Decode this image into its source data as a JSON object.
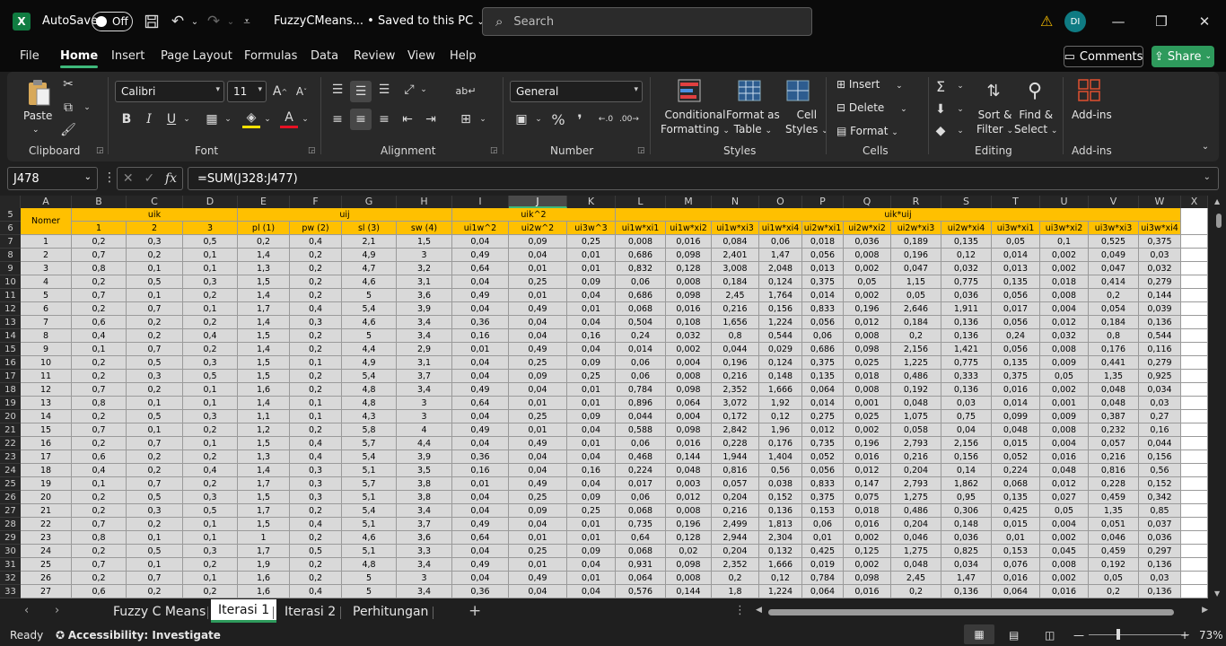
{
  "titlebar": {
    "logo": "X",
    "autosave_label": "AutoSave",
    "autosave_state": "Off",
    "doc_title": "FuzzyCMeans...  •  Saved to this PC",
    "search_placeholder": "Search",
    "avatar_initials": "DI"
  },
  "menu": {
    "tabs": [
      "File",
      "Home",
      "Insert",
      "Page Layout",
      "Formulas",
      "Data",
      "Review",
      "View",
      "Help"
    ],
    "active": "Home",
    "comments_label": "Comments",
    "share_label": "Share"
  },
  "ribbon": {
    "groups": [
      "Clipboard",
      "Font",
      "Alignment",
      "Number",
      "Styles",
      "Cells",
      "Editing",
      "Add-ins"
    ],
    "paste_label": "Paste",
    "font_name": "Calibri",
    "font_size": "11",
    "number_format": "General",
    "conditional_formatting": [
      "Conditional",
      "Formatting"
    ],
    "format_as_table": [
      "Format as",
      "Table"
    ],
    "cell_styles": [
      "Cell",
      "Styles"
    ],
    "insert_label": "Insert",
    "delete_label": "Delete",
    "format_label": "Format",
    "sort_filter": [
      "Sort &",
      "Filter"
    ],
    "find_select": [
      "Find &",
      "Select"
    ],
    "addins_label": "Add-ins"
  },
  "formula_bar": {
    "name_box": "J478",
    "formula": "=SUM(J328:J477)"
  },
  "columns": [
    {
      "id": "A",
      "w": 57
    },
    {
      "id": "B",
      "w": 61
    },
    {
      "id": "C",
      "w": 63
    },
    {
      "id": "D",
      "w": 61
    },
    {
      "id": "E",
      "w": 58
    },
    {
      "id": "F",
      "w": 58
    },
    {
      "id": "G",
      "w": 61
    },
    {
      "id": "H",
      "w": 62
    },
    {
      "id": "I",
      "w": 63
    },
    {
      "id": "J",
      "w": 65
    },
    {
      "id": "K",
      "w": 54
    },
    {
      "id": "L",
      "w": 56
    },
    {
      "id": "M",
      "w": 51
    },
    {
      "id": "N",
      "w": 53
    },
    {
      "id": "O",
      "w": 48
    },
    {
      "id": "P",
      "w": 46
    },
    {
      "id": "Q",
      "w": 53
    },
    {
      "id": "R",
      "w": 56
    },
    {
      "id": "S",
      "w": 56
    },
    {
      "id": "T",
      "w": 54
    },
    {
      "id": "U",
      "w": 54
    },
    {
      "id": "V",
      "w": 56
    },
    {
      "id": "W",
      "w": 47
    }
  ],
  "selected_column": "J",
  "sheet": {
    "header_row5": [
      {
        "label": "Nomer",
        "span": 1
      },
      {
        "label": "uik",
        "span": 3
      },
      {
        "label": "uij",
        "span": 4
      },
      {
        "label": "uik^2",
        "span": 3
      },
      {
        "label": "uik*uij",
        "span": 12
      }
    ],
    "header_row6": [
      "1",
      "2",
      "3",
      "pl (1)",
      "pw (2)",
      "sl (3)",
      "sw (4)",
      "ui1w^2",
      "ui2w^2",
      "ui3w^3",
      "ui1w*xi1",
      "ui1w*xi2",
      "ui1w*xi3",
      "ui1w*xi4",
      "ui2w*xi1",
      "ui2w*xi2",
      "ui2w*xi3",
      "ui2w*xi4",
      "ui3w*xi1",
      "ui3w*xi2",
      "ui3w*xi3",
      "ui3w*xi4"
    ],
    "rows": [
      {
        "r": "7",
        "v": [
          "1",
          "0,2",
          "0,3",
          "0,5",
          "0,2",
          "0,4",
          "2,1",
          "1,5",
          "0,04",
          "0,09",
          "0,25",
          "0,008",
          "0,016",
          "0,084",
          "0,06",
          "0,018",
          "0,036",
          "0,189",
          "0,135",
          "0,05",
          "0,1",
          "0,525",
          "0,375"
        ]
      },
      {
        "r": "8",
        "v": [
          "2",
          "0,7",
          "0,2",
          "0,1",
          "1,4",
          "0,2",
          "4,9",
          "3",
          "0,49",
          "0,04",
          "0,01",
          "0,686",
          "0,098",
          "2,401",
          "1,47",
          "0,056",
          "0,008",
          "0,196",
          "0,12",
          "0,014",
          "0,002",
          "0,049",
          "0,03"
        ]
      },
      {
        "r": "9",
        "v": [
          "3",
          "0,8",
          "0,1",
          "0,1",
          "1,3",
          "0,2",
          "4,7",
          "3,2",
          "0,64",
          "0,01",
          "0,01",
          "0,832",
          "0,128",
          "3,008",
          "2,048",
          "0,013",
          "0,002",
          "0,047",
          "0,032",
          "0,013",
          "0,002",
          "0,047",
          "0,032"
        ]
      },
      {
        "r": "10",
        "v": [
          "4",
          "0,2",
          "0,5",
          "0,3",
          "1,5",
          "0,2",
          "4,6",
          "3,1",
          "0,04",
          "0,25",
          "0,09",
          "0,06",
          "0,008",
          "0,184",
          "0,124",
          "0,375",
          "0,05",
          "1,15",
          "0,775",
          "0,135",
          "0,018",
          "0,414",
          "0,279"
        ]
      },
      {
        "r": "11",
        "v": [
          "5",
          "0,7",
          "0,1",
          "0,2",
          "1,4",
          "0,2",
          "5",
          "3,6",
          "0,49",
          "0,01",
          "0,04",
          "0,686",
          "0,098",
          "2,45",
          "1,764",
          "0,014",
          "0,002",
          "0,05",
          "0,036",
          "0,056",
          "0,008",
          "0,2",
          "0,144"
        ]
      },
      {
        "r": "12",
        "v": [
          "6",
          "0,2",
          "0,7",
          "0,1",
          "1,7",
          "0,4",
          "5,4",
          "3,9",
          "0,04",
          "0,49",
          "0,01",
          "0,068",
          "0,016",
          "0,216",
          "0,156",
          "0,833",
          "0,196",
          "2,646",
          "1,911",
          "0,017",
          "0,004",
          "0,054",
          "0,039"
        ]
      },
      {
        "r": "13",
        "v": [
          "7",
          "0,6",
          "0,2",
          "0,2",
          "1,4",
          "0,3",
          "4,6",
          "3,4",
          "0,36",
          "0,04",
          "0,04",
          "0,504",
          "0,108",
          "1,656",
          "1,224",
          "0,056",
          "0,012",
          "0,184",
          "0,136",
          "0,056",
          "0,012",
          "0,184",
          "0,136"
        ]
      },
      {
        "r": "14",
        "v": [
          "8",
          "0,4",
          "0,2",
          "0,4",
          "1,5",
          "0,2",
          "5",
          "3,4",
          "0,16",
          "0,04",
          "0,16",
          "0,24",
          "0,032",
          "0,8",
          "0,544",
          "0,06",
          "0,008",
          "0,2",
          "0,136",
          "0,24",
          "0,032",
          "0,8",
          "0,544"
        ]
      },
      {
        "r": "15",
        "v": [
          "9",
          "0,1",
          "0,7",
          "0,2",
          "1,4",
          "0,2",
          "4,4",
          "2,9",
          "0,01",
          "0,49",
          "0,04",
          "0,014",
          "0,002",
          "0,044",
          "0,029",
          "0,686",
          "0,098",
          "2,156",
          "1,421",
          "0,056",
          "0,008",
          "0,176",
          "0,116"
        ]
      },
      {
        "r": "16",
        "v": [
          "10",
          "0,2",
          "0,5",
          "0,3",
          "1,5",
          "0,1",
          "4,9",
          "3,1",
          "0,04",
          "0,25",
          "0,09",
          "0,06",
          "0,004",
          "0,196",
          "0,124",
          "0,375",
          "0,025",
          "1,225",
          "0,775",
          "0,135",
          "0,009",
          "0,441",
          "0,279"
        ]
      },
      {
        "r": "17",
        "v": [
          "11",
          "0,2",
          "0,3",
          "0,5",
          "1,5",
          "0,2",
          "5,4",
          "3,7",
          "0,04",
          "0,09",
          "0,25",
          "0,06",
          "0,008",
          "0,216",
          "0,148",
          "0,135",
          "0,018",
          "0,486",
          "0,333",
          "0,375",
          "0,05",
          "1,35",
          "0,925"
        ]
      },
      {
        "r": "18",
        "v": [
          "12",
          "0,7",
          "0,2",
          "0,1",
          "1,6",
          "0,2",
          "4,8",
          "3,4",
          "0,49",
          "0,04",
          "0,01",
          "0,784",
          "0,098",
          "2,352",
          "1,666",
          "0,064",
          "0,008",
          "0,192",
          "0,136",
          "0,016",
          "0,002",
          "0,048",
          "0,034"
        ]
      },
      {
        "r": "19",
        "v": [
          "13",
          "0,8",
          "0,1",
          "0,1",
          "1,4",
          "0,1",
          "4,8",
          "3",
          "0,64",
          "0,01",
          "0,01",
          "0,896",
          "0,064",
          "3,072",
          "1,92",
          "0,014",
          "0,001",
          "0,048",
          "0,03",
          "0,014",
          "0,001",
          "0,048",
          "0,03"
        ]
      },
      {
        "r": "20",
        "v": [
          "14",
          "0,2",
          "0,5",
          "0,3",
          "1,1",
          "0,1",
          "4,3",
          "3",
          "0,04",
          "0,25",
          "0,09",
          "0,044",
          "0,004",
          "0,172",
          "0,12",
          "0,275",
          "0,025",
          "1,075",
          "0,75",
          "0,099",
          "0,009",
          "0,387",
          "0,27"
        ]
      },
      {
        "r": "21",
        "v": [
          "15",
          "0,7",
          "0,1",
          "0,2",
          "1,2",
          "0,2",
          "5,8",
          "4",
          "0,49",
          "0,01",
          "0,04",
          "0,588",
          "0,098",
          "2,842",
          "1,96",
          "0,012",
          "0,002",
          "0,058",
          "0,04",
          "0,048",
          "0,008",
          "0,232",
          "0,16"
        ]
      },
      {
        "r": "22",
        "v": [
          "16",
          "0,2",
          "0,7",
          "0,1",
          "1,5",
          "0,4",
          "5,7",
          "4,4",
          "0,04",
          "0,49",
          "0,01",
          "0,06",
          "0,016",
          "0,228",
          "0,176",
          "0,735",
          "0,196",
          "2,793",
          "2,156",
          "0,015",
          "0,004",
          "0,057",
          "0,044"
        ]
      },
      {
        "r": "23",
        "v": [
          "17",
          "0,6",
          "0,2",
          "0,2",
          "1,3",
          "0,4",
          "5,4",
          "3,9",
          "0,36",
          "0,04",
          "0,04",
          "0,468",
          "0,144",
          "1,944",
          "1,404",
          "0,052",
          "0,016",
          "0,216",
          "0,156",
          "0,052",
          "0,016",
          "0,216",
          "0,156"
        ]
      },
      {
        "r": "24",
        "v": [
          "18",
          "0,4",
          "0,2",
          "0,4",
          "1,4",
          "0,3",
          "5,1",
          "3,5",
          "0,16",
          "0,04",
          "0,16",
          "0,224",
          "0,048",
          "0,816",
          "0,56",
          "0,056",
          "0,012",
          "0,204",
          "0,14",
          "0,224",
          "0,048",
          "0,816",
          "0,56"
        ]
      },
      {
        "r": "25",
        "v": [
          "19",
          "0,1",
          "0,7",
          "0,2",
          "1,7",
          "0,3",
          "5,7",
          "3,8",
          "0,01",
          "0,49",
          "0,04",
          "0,017",
          "0,003",
          "0,057",
          "0,038",
          "0,833",
          "0,147",
          "2,793",
          "1,862",
          "0,068",
          "0,012",
          "0,228",
          "0,152"
        ]
      },
      {
        "r": "26",
        "v": [
          "20",
          "0,2",
          "0,5",
          "0,3",
          "1,5",
          "0,3",
          "5,1",
          "3,8",
          "0,04",
          "0,25",
          "0,09",
          "0,06",
          "0,012",
          "0,204",
          "0,152",
          "0,375",
          "0,075",
          "1,275",
          "0,95",
          "0,135",
          "0,027",
          "0,459",
          "0,342"
        ]
      },
      {
        "r": "27",
        "v": [
          "21",
          "0,2",
          "0,3",
          "0,5",
          "1,7",
          "0,2",
          "5,4",
          "3,4",
          "0,04",
          "0,09",
          "0,25",
          "0,068",
          "0,008",
          "0,216",
          "0,136",
          "0,153",
          "0,018",
          "0,486",
          "0,306",
          "0,425",
          "0,05",
          "1,35",
          "0,85"
        ]
      },
      {
        "r": "28",
        "v": [
          "22",
          "0,7",
          "0,2",
          "0,1",
          "1,5",
          "0,4",
          "5,1",
          "3,7",
          "0,49",
          "0,04",
          "0,01",
          "0,735",
          "0,196",
          "2,499",
          "1,813",
          "0,06",
          "0,016",
          "0,204",
          "0,148",
          "0,015",
          "0,004",
          "0,051",
          "0,037"
        ]
      },
      {
        "r": "29",
        "v": [
          "23",
          "0,8",
          "0,1",
          "0,1",
          "1",
          "0,2",
          "4,6",
          "3,6",
          "0,64",
          "0,01",
          "0,01",
          "0,64",
          "0,128",
          "2,944",
          "2,304",
          "0,01",
          "0,002",
          "0,046",
          "0,036",
          "0,01",
          "0,002",
          "0,046",
          "0,036"
        ]
      },
      {
        "r": "30",
        "v": [
          "24",
          "0,2",
          "0,5",
          "0,3",
          "1,7",
          "0,5",
          "5,1",
          "3,3",
          "0,04",
          "0,25",
          "0,09",
          "0,068",
          "0,02",
          "0,204",
          "0,132",
          "0,425",
          "0,125",
          "1,275",
          "0,825",
          "0,153",
          "0,045",
          "0,459",
          "0,297"
        ]
      },
      {
        "r": "31",
        "v": [
          "25",
          "0,7",
          "0,1",
          "0,2",
          "1,9",
          "0,2",
          "4,8",
          "3,4",
          "0,49",
          "0,01",
          "0,04",
          "0,931",
          "0,098",
          "2,352",
          "1,666",
          "0,019",
          "0,002",
          "0,048",
          "0,034",
          "0,076",
          "0,008",
          "0,192",
          "0,136"
        ]
      },
      {
        "r": "32",
        "v": [
          "26",
          "0,2",
          "0,7",
          "0,1",
          "1,6",
          "0,2",
          "5",
          "3",
          "0,04",
          "0,49",
          "0,01",
          "0,064",
          "0,008",
          "0,2",
          "0,12",
          "0,784",
          "0,098",
          "2,45",
          "1,47",
          "0,016",
          "0,002",
          "0,05",
          "0,03"
        ]
      },
      {
        "r": "33",
        "v": [
          "27",
          "0,6",
          "0,2",
          "0,2",
          "1,6",
          "0,4",
          "5",
          "3,4",
          "0,36",
          "0,04",
          "0,04",
          "0,576",
          "0,144",
          "1,8",
          "1,224",
          "0,064",
          "0,016",
          "0,2",
          "0,136",
          "0,064",
          "0,016",
          "0,2",
          "0,136"
        ]
      }
    ]
  },
  "sheet_tabs": {
    "tabs": [
      "Fuzzy C Means",
      "Iterasi 1",
      "Iterasi 2",
      "Perhitungan"
    ],
    "active": "Iterasi 1"
  },
  "statusbar": {
    "ready": "Ready",
    "accessibility": "Accessibility: Investigate",
    "zoom": "73%"
  },
  "colors": {
    "header_fill": "#ffc000",
    "data_fill": "#d9d9d9",
    "accent_green": "#2e9a5c"
  }
}
